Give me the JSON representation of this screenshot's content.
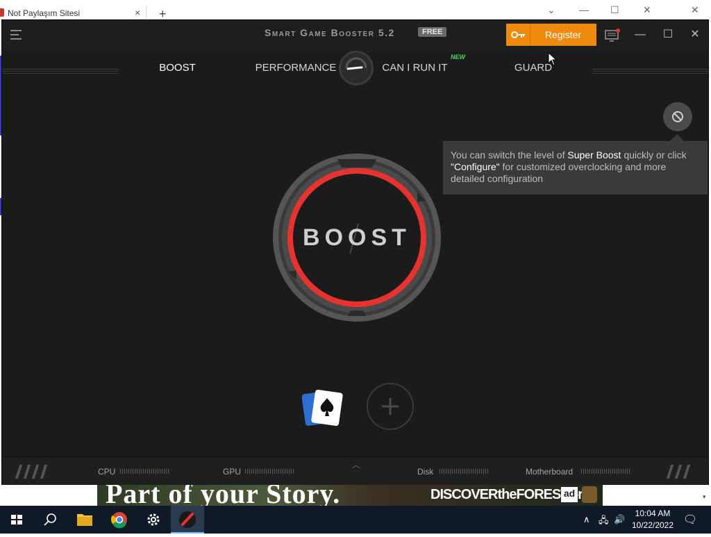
{
  "browser": {
    "tab_title": "Not Paylaşım Sitesi",
    "tab_close": "×",
    "new_tab": "+",
    "ad_left": "Part of your Story.",
    "ad_right": "DISCOVERtheFOREST.org",
    "ad_logo1": "ad",
    "scroll_down": "▾"
  },
  "app": {
    "title": "Smart Game Booster 5.2",
    "badge": "FREE",
    "register_label": "Register",
    "tabs": [
      {
        "label": "BOOST",
        "active": true
      },
      {
        "label": "PERFORMANCE",
        "active": false
      },
      {
        "label": "CAN I RUN IT",
        "active": false
      },
      {
        "label": "GUARD",
        "active": false
      }
    ],
    "new_badge": "NEW",
    "tooltip": {
      "text1": "You can switch the level of ",
      "highlight1": "Super Boost",
      "text2": " quickly or click ",
      "highlight2": "\"Configure\"",
      "text3": " for customized overclocking and more detailed configuration"
    },
    "boost_label": "BOOST",
    "status": {
      "cpu": "CPU",
      "gpu": "GPU",
      "disk": "Disk",
      "motherboard": "Motherboard"
    },
    "accent_color": "#e8322f",
    "register_color": "#f08a0c"
  },
  "taskbar": {
    "time": "10:04 AM",
    "date": "10/22/2022"
  }
}
